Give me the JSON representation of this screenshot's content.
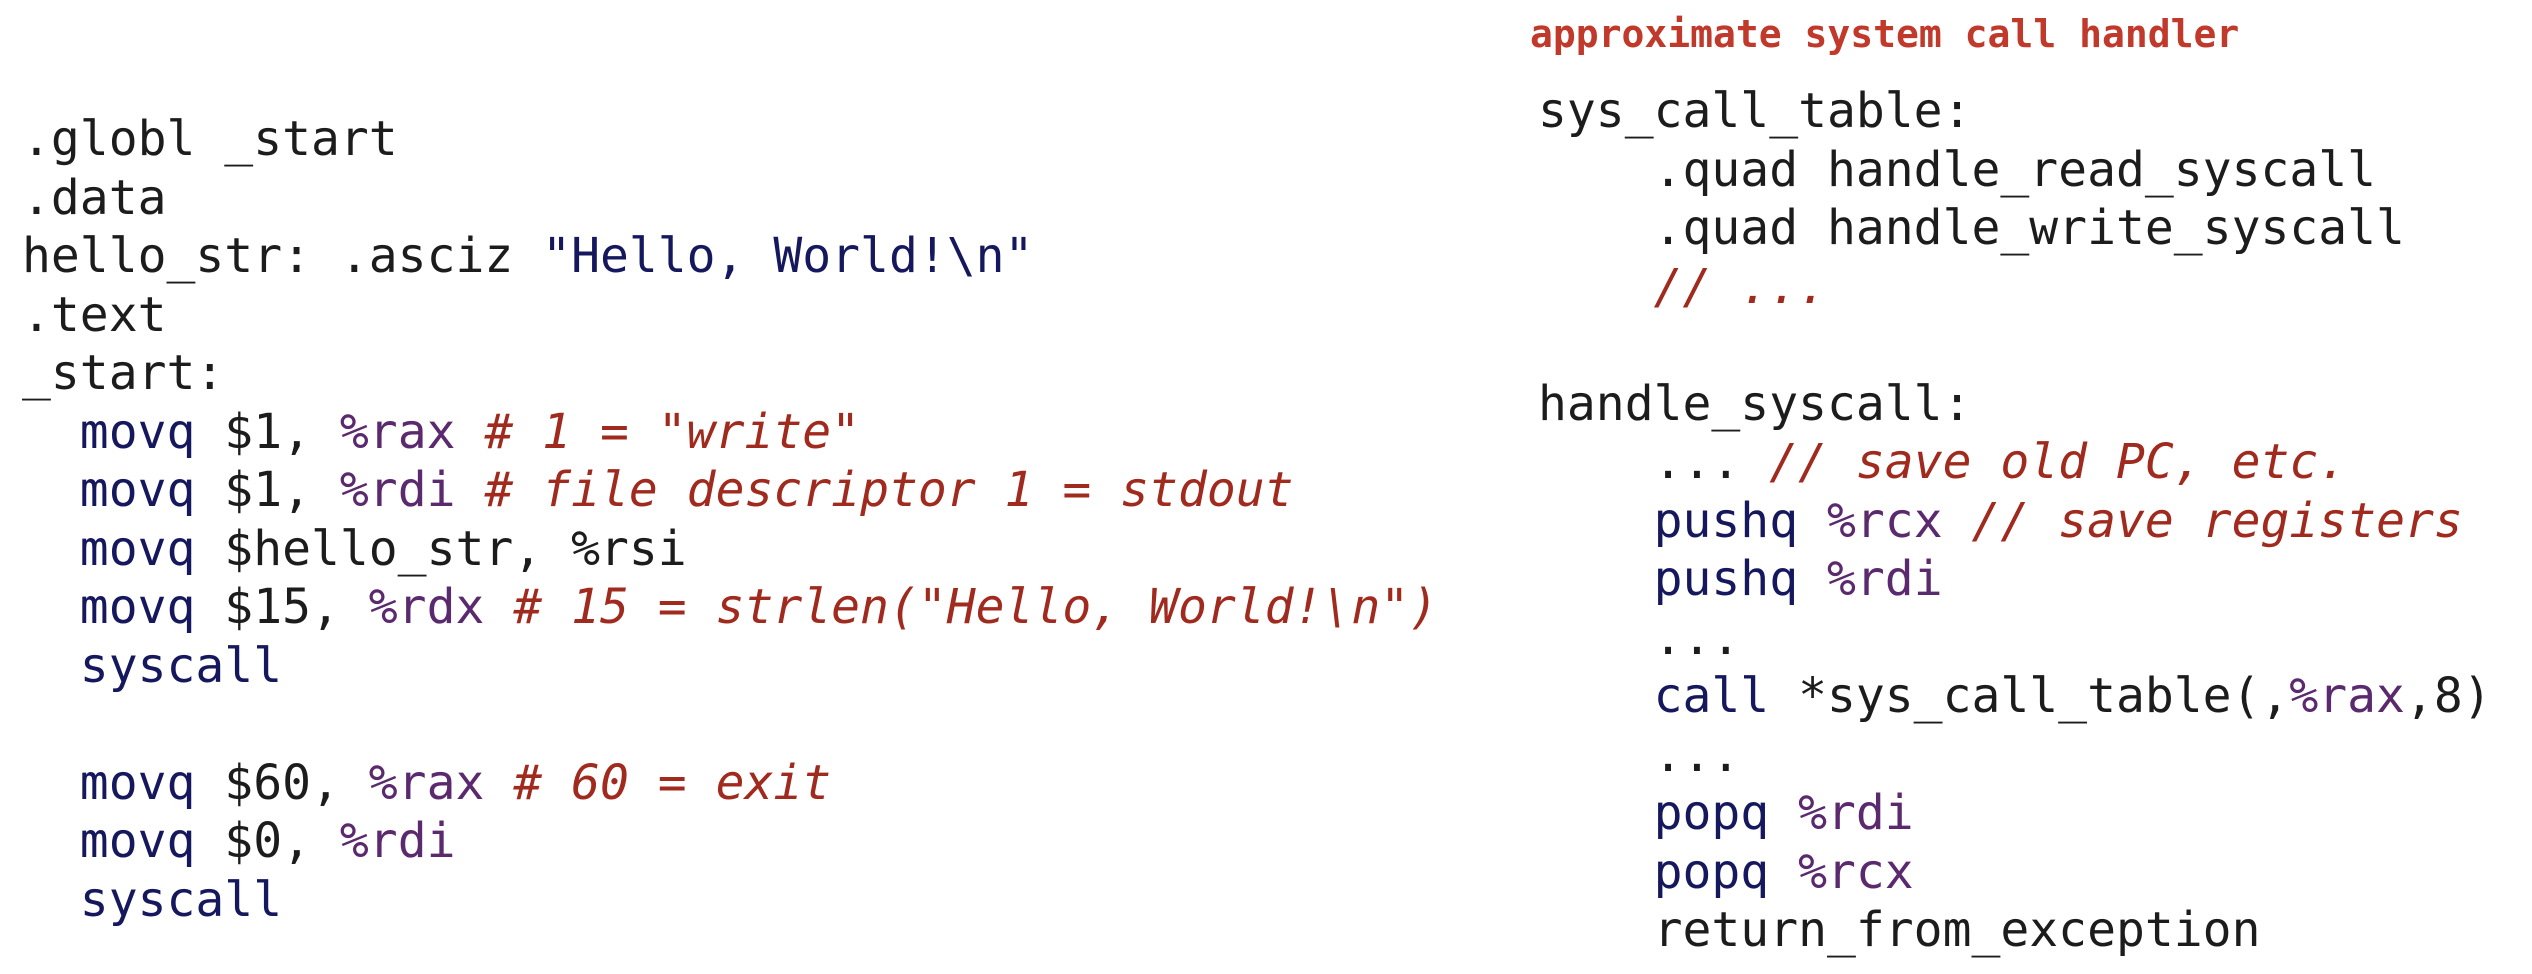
{
  "colors": {
    "heading": "#c0392b",
    "keyword": "#16185e",
    "register": "#5b2a6e",
    "comment": "#a12a1e",
    "text": "#1c1c1c",
    "background": "#ffffff"
  },
  "heading": "approximate system call handler",
  "left": {
    "l1": ".globl _start",
    "l2": ".data",
    "l3_label": "hello_str: .asciz ",
    "l3_string": "\"Hello, World!\\n\"",
    "l4": ".text",
    "l5": "_start:",
    "l6": {
      "op": "movq",
      "arg": " $1, ",
      "reg": "%rax",
      "comment": " # 1 = \"write\""
    },
    "l7": {
      "op": "movq",
      "arg": " $1, ",
      "reg": "%rdi",
      "comment": " # file descriptor 1 = stdout"
    },
    "l8": {
      "op": "movq",
      "arg": " $hello_str, %rsi"
    },
    "l9": {
      "op": "movq",
      "arg": " $15, ",
      "reg": "%rdx",
      "comment": " # 15 = strlen(\"Hello, World!\\n\")"
    },
    "l10": {
      "op": "syscall"
    },
    "l12": {
      "op": "movq",
      "arg": " $60, ",
      "reg": "%rax",
      "comment": " # 60 = exit"
    },
    "l13": {
      "op": "movq",
      "arg": " $0, ",
      "reg": "%rdi"
    },
    "l14": {
      "op": "syscall"
    }
  },
  "right": {
    "r1": "sys_call_table:",
    "r2": ".quad handle_read_syscall",
    "r3": ".quad handle_write_syscall",
    "r4": "// ...",
    "r6": "handle_syscall:",
    "r7": {
      "text": "... ",
      "comment": "// save old PC, etc."
    },
    "r8": {
      "op": "pushq",
      "reg": " %rcx",
      "comment": " // save registers"
    },
    "r9": {
      "op": "pushq",
      "reg": " %rdi"
    },
    "r10": "...",
    "r11": {
      "op": "call",
      "arg1": " *sys_call_table(,",
      "reg": "%rax",
      "arg2": ",8)"
    },
    "r12": "...",
    "r13": {
      "op": "popq",
      "reg": " %rdi"
    },
    "r14": {
      "op": "popq",
      "reg": " %rcx"
    },
    "r15": "return_from_exception"
  }
}
